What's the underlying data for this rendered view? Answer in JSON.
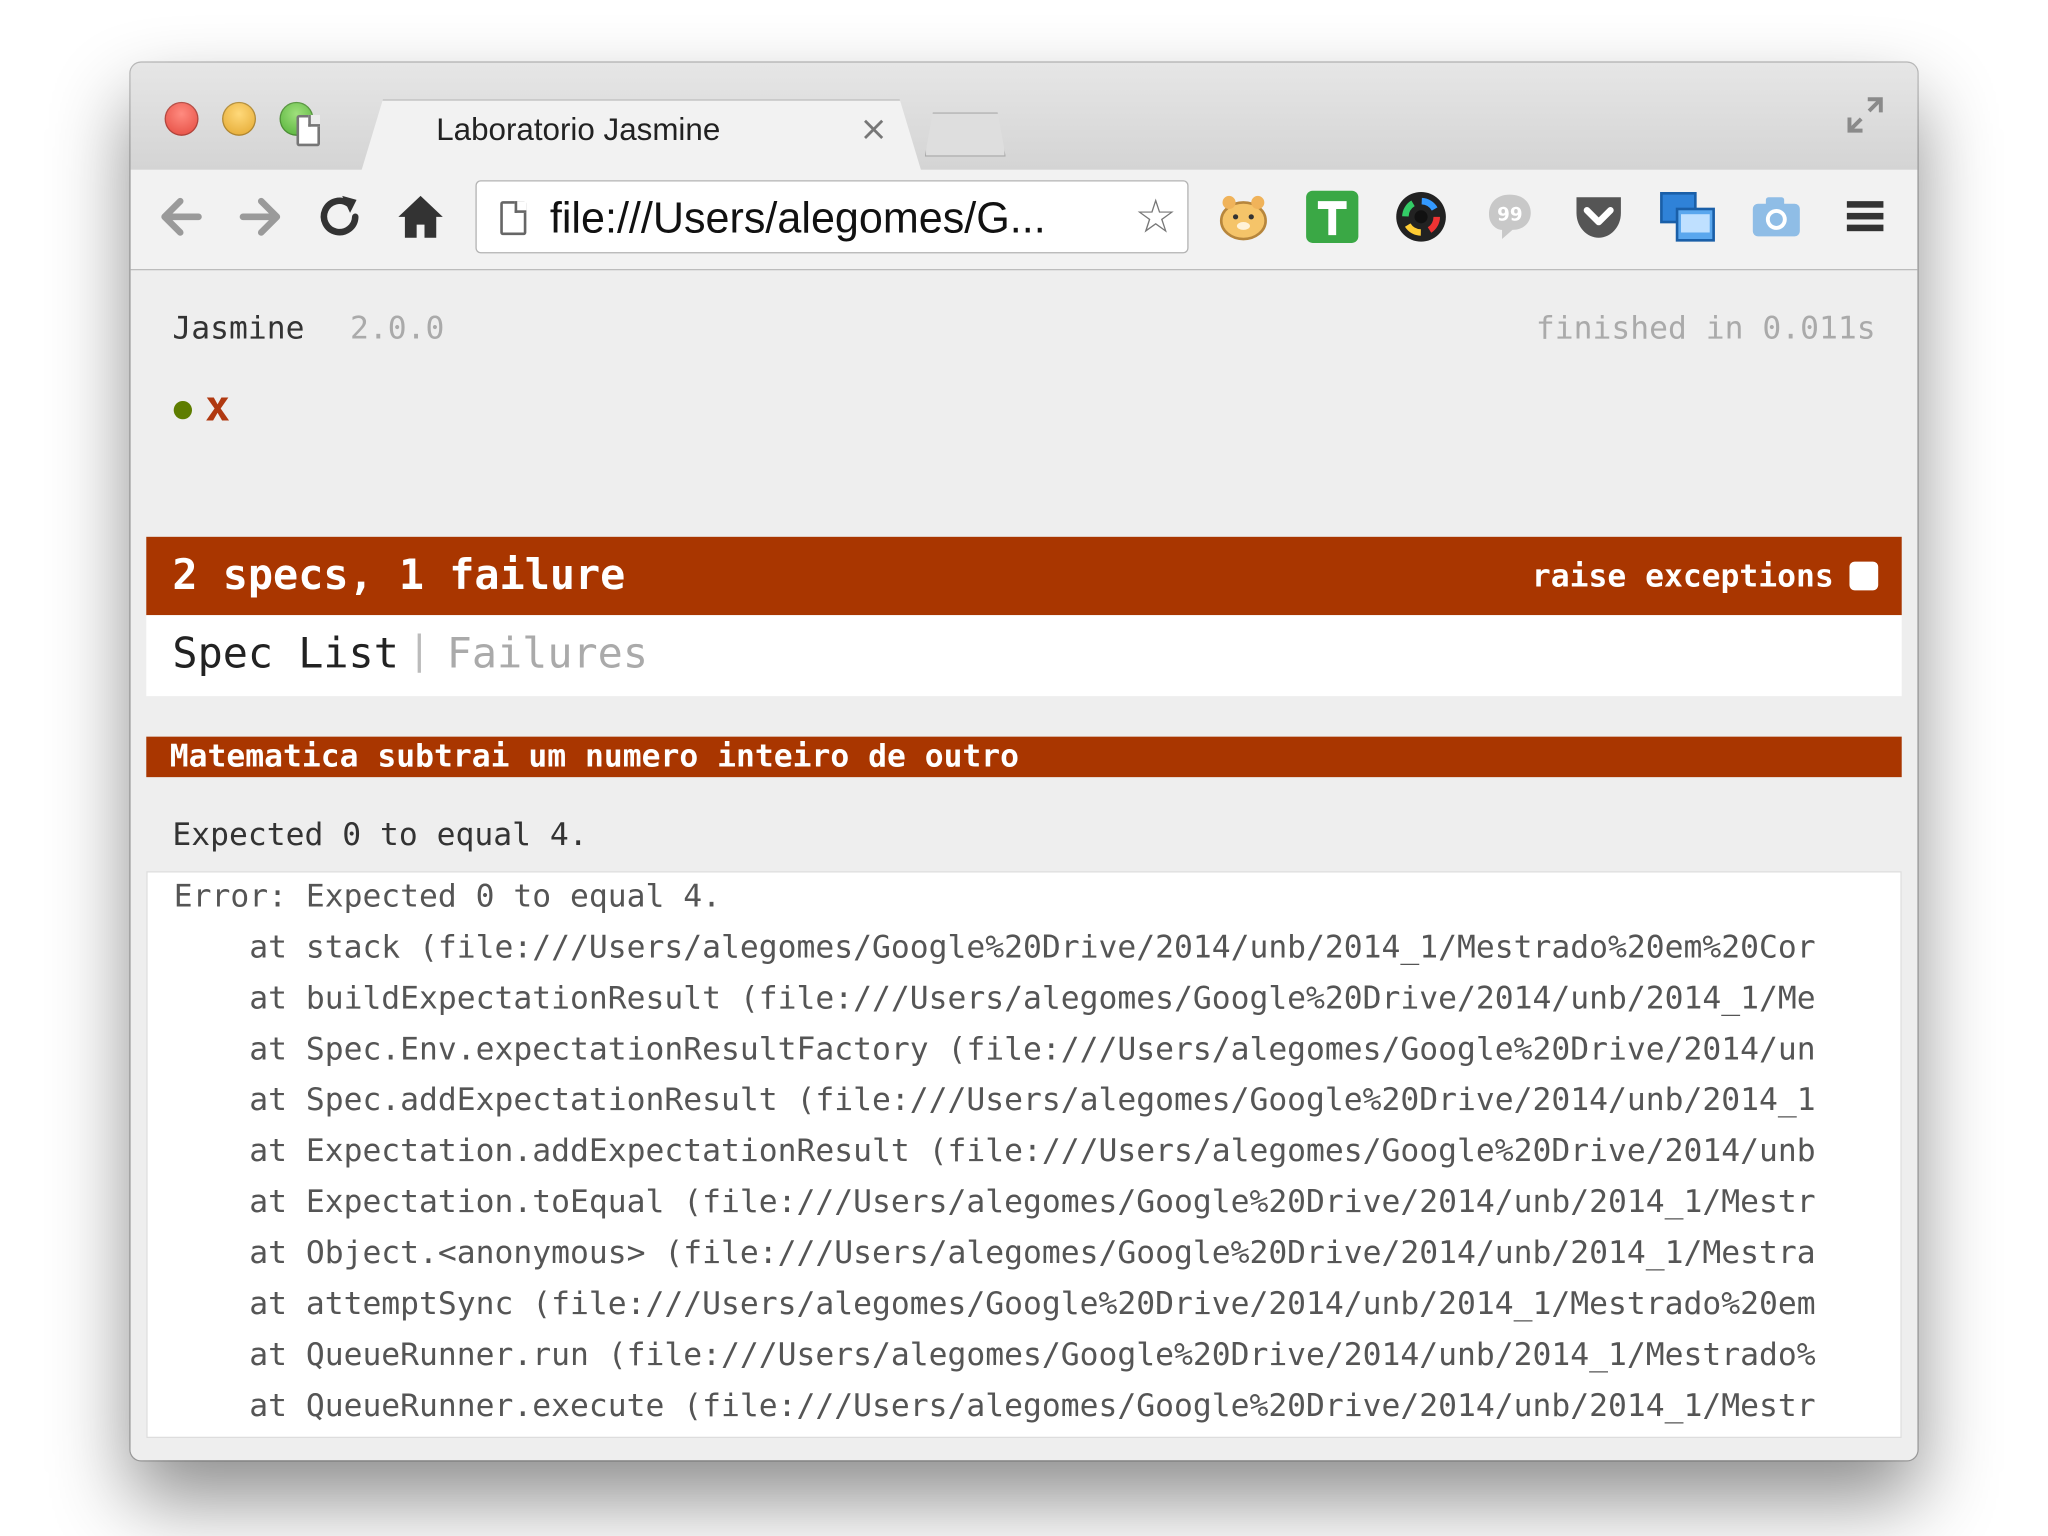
{
  "browser": {
    "tab_title": "Laboratorio Jasmine",
    "tab_close": "×",
    "url": "file:///Users/alegomes/G...",
    "icons": [
      "back-icon",
      "forward-icon",
      "reload-icon",
      "home-icon",
      "page-icon",
      "star-icon",
      "fullscreen-icon",
      "menu-icon"
    ],
    "extensions": [
      "hamster-extension-icon",
      "t-extension-icon",
      "color-wheel-extension-icon",
      "quote-extension-icon",
      "pocket-extension-icon",
      "screen-share-extension-icon",
      "camera-extension-icon"
    ]
  },
  "jasmine": {
    "name": "Jasmine",
    "version": "2.0.0",
    "duration": "finished in 0.011s",
    "fail_symbol": "x",
    "summary": "2 specs, 1 failure",
    "raise_exceptions_label": "raise exceptions",
    "menu": {
      "spec_list": "Spec List",
      "separator": "|",
      "failures": "Failures"
    },
    "failure": {
      "description": "Matematica subtrai um numero inteiro de outro",
      "message": "Expected 0 to equal 4.",
      "stack": [
        "Error: Expected 0 to equal 4.",
        "    at stack (file:///Users/alegomes/Google%20Drive/2014/unb/2014_1/Mestrado%20em%20Cor",
        "    at buildExpectationResult (file:///Users/alegomes/Google%20Drive/2014/unb/2014_1/Me",
        "    at Spec.Env.expectationResultFactory (file:///Users/alegomes/Google%20Drive/2014/un",
        "    at Spec.addExpectationResult (file:///Users/alegomes/Google%20Drive/2014/unb/2014_1",
        "    at Expectation.addExpectationResult (file:///Users/alegomes/Google%20Drive/2014/unb",
        "    at Expectation.toEqual (file:///Users/alegomes/Google%20Drive/2014/unb/2014_1/Mestr",
        "    at Object.<anonymous> (file:///Users/alegomes/Google%20Drive/2014/unb/2014_1/Mestra",
        "    at attemptSync (file:///Users/alegomes/Google%20Drive/2014/unb/2014_1/Mestrado%20em",
        "    at QueueRunner.run (file:///Users/alegomes/Google%20Drive/2014/unb/2014_1/Mestrado%",
        "    at QueueRunner.execute (file:///Users/alegomes/Google%20Drive/2014/unb/2014_1/Mestr"
      ]
    },
    "colors": {
      "failure": "#a93600",
      "pass": "#5e7d00",
      "fail_symbol": "#b03911"
    }
  }
}
